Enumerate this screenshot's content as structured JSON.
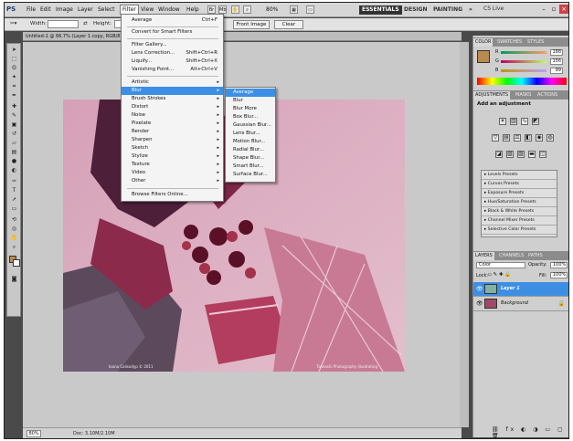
{
  "app": {
    "logo": "PS"
  },
  "menubar": {
    "items": [
      "File",
      "Edit",
      "Image",
      "Layer",
      "Select",
      "Filter",
      "View",
      "Window",
      "Help"
    ],
    "zoom": "80%",
    "workspaces": [
      "ESSENTIALS",
      "DESIGN",
      "PAINTING"
    ],
    "more": "»",
    "cslive": "CS Live"
  },
  "options": {
    "width_label": "Width:",
    "height_label": "Height:",
    "front_image": "Front Image",
    "clear": "Clear"
  },
  "document": {
    "tab_title": "Untitled-1 @ 66.7% (Layer 1 copy, RGB/8)",
    "caption_left": "Ioana Calisodyp © 2011",
    "caption_right": "Takeashi Photography Illustrating"
  },
  "status": {
    "zoom": "80%",
    "doc": "Doc: 3.10M/2.10M"
  },
  "filter_menu": {
    "items": [
      {
        "label": "Average",
        "shortcut": "Ctrl+F"
      },
      {
        "label": "Convert for Smart Filters",
        "shortcut": ""
      },
      {
        "label": "Filter Gallery...",
        "shortcut": ""
      },
      {
        "label": "Lens Correction...",
        "shortcut": "Shift+Ctrl+R"
      },
      {
        "label": "Liquify...",
        "shortcut": "Shift+Ctrl+X"
      },
      {
        "label": "Vanishing Point...",
        "shortcut": "Alt+Ctrl+V"
      },
      {
        "label": "Artistic"
      },
      {
        "label": "Blur"
      },
      {
        "label": "Brush Strokes"
      },
      {
        "label": "Distort"
      },
      {
        "label": "Noise"
      },
      {
        "label": "Pixelate"
      },
      {
        "label": "Render"
      },
      {
        "label": "Sharpen"
      },
      {
        "label": "Sketch"
      },
      {
        "label": "Stylize"
      },
      {
        "label": "Texture"
      },
      {
        "label": "Video"
      },
      {
        "label": "Other"
      },
      {
        "label": "Browse Filters Online..."
      }
    ],
    "submenu_arrow": "▸"
  },
  "blur_submenu": {
    "items": [
      "Average",
      "Blur",
      "Blur More",
      "Box Blur...",
      "Gaussian Blur...",
      "Lens Blur...",
      "Motion Blur...",
      "Radial Blur...",
      "Shape Blur...",
      "Smart Blur...",
      "Surface Blur..."
    ]
  },
  "panels": {
    "color_tabs": [
      "COLOR",
      "SWATCHES",
      "STYLES"
    ],
    "channels": [
      {
        "ch": "R",
        "value": "188"
      },
      {
        "ch": "G",
        "value": "156"
      },
      {
        "ch": "B",
        "value": "99"
      }
    ],
    "adjust_tabs": [
      "ADJUSTMENTS",
      "MASKS",
      "ACTIONS"
    ],
    "adjust_title": "Add an adjustment",
    "presets": [
      "Levels Presets",
      "Curves Presets",
      "Exposure Presets",
      "Hue/Saturation Presets",
      "Black & White Presets",
      "Channel Mixer Presets",
      "Selective Color Presets"
    ],
    "layer_tabs": [
      "LAYERS",
      "CHANNELS",
      "PATHS"
    ],
    "blend_mode": "Color",
    "opacity_label": "Opacity:",
    "opacity": "100%",
    "lock_label": "Lock:",
    "fill_label": "Fill:",
    "fill": "100%",
    "layers": [
      {
        "name": "Layer 1"
      },
      {
        "name": "Background"
      }
    ]
  },
  "colors": {
    "accent": "#3d8fe4",
    "foreground": "#b98a4f"
  }
}
